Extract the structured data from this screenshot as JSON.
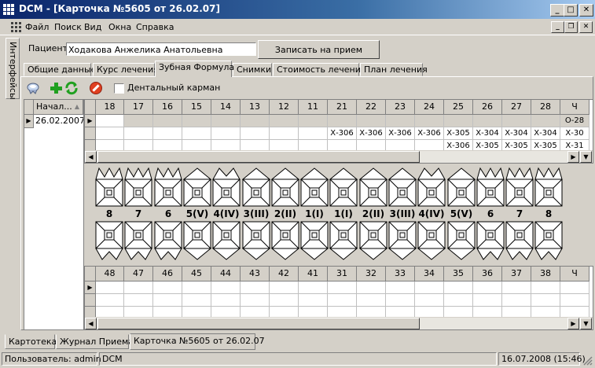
{
  "window": {
    "title": "DCM - [Карточка №5605 от 26.02.07]",
    "colors": {
      "titlebar": "#0a246a",
      "face": "#d4d0c8"
    }
  },
  "menu": [
    "Файл",
    "Поиск",
    "Вид",
    "Окна",
    "Справка"
  ],
  "side_tab": "Интерфейсы",
  "patient": {
    "label": "Пациент",
    "name": "Ходакова Анжелика Анатольевна",
    "record_button": "Записать на прием"
  },
  "tabs": [
    {
      "label": "Общие данные",
      "active": false
    },
    {
      "label": "Курс лечения",
      "active": false
    },
    {
      "label": "Зубная Формула",
      "active": true
    },
    {
      "label": "Снимки",
      "active": false
    },
    {
      "label": "Стоимость лечения",
      "active": false
    },
    {
      "label": "План лечения",
      "active": false
    }
  ],
  "toolbar": {
    "icons": [
      "tooth-icon",
      "add-icon",
      "refresh-icon",
      "delete-icon"
    ],
    "dental_pocket_label": "Дентальный карман"
  },
  "date_list": {
    "header": "Начал...",
    "sort_indicator": "▲",
    "rows": [
      "26.02.2007"
    ]
  },
  "upper_grid": {
    "columns": [
      "18",
      "17",
      "16",
      "15",
      "14",
      "13",
      "12",
      "11",
      "21",
      "22",
      "23",
      "24",
      "25",
      "26",
      "27",
      "28",
      "Ч"
    ],
    "rows": [
      [
        "",
        "",
        "",
        "",
        "",
        "",
        "",
        "",
        "",
        "",
        "",
        "",
        "",
        "",
        "",
        "",
        "О-28"
      ],
      [
        "",
        "",
        "",
        "",
        "",
        "",
        "",
        "",
        "Х-306",
        "Х-306",
        "Х-306",
        "Х-306",
        "Х-305",
        "Х-304",
        "Х-304",
        "Х-304",
        "Х-30"
      ],
      [
        "",
        "",
        "",
        "",
        "",
        "",
        "",
        "",
        "",
        "",
        "",
        "",
        "Х-306",
        "Х-305",
        "Х-305",
        "Х-305",
        "Х-31"
      ]
    ]
  },
  "teeth_labels": [
    "8",
    "7",
    "6",
    "5(V)",
    "4(IV)",
    "3(III)",
    "2(II)",
    "1(I)",
    "1(I)",
    "2(II)",
    "3(III)",
    "4(IV)",
    "5(V)",
    "6",
    "7",
    "8"
  ],
  "lower_grid": {
    "columns": [
      "48",
      "47",
      "46",
      "45",
      "44",
      "43",
      "42",
      "41",
      "31",
      "32",
      "33",
      "34",
      "35",
      "36",
      "37",
      "38",
      "Ч"
    ],
    "row_count": 3
  },
  "bottom_tabs": [
    {
      "label": "Картотека",
      "active": false
    },
    {
      "label": "Журнал Приема",
      "active": false
    },
    {
      "label": "Карточка №5605 от 26.02.07",
      "active": true
    }
  ],
  "status": {
    "user": "Пользователь: admin",
    "app": "DCM",
    "datetime": "16.07.2008 (15:46)"
  }
}
